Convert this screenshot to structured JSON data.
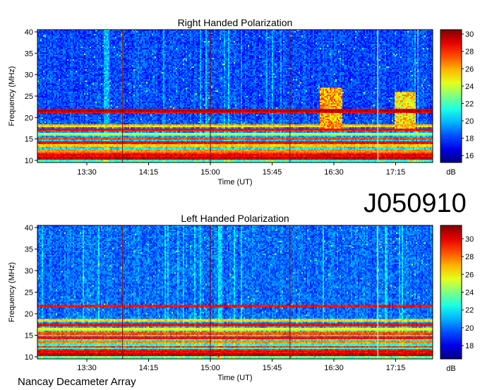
{
  "figure_id": "J050910",
  "footer": "Nancay Decameter Array",
  "chart_data": [
    {
      "type": "heatmap",
      "title": "Right Handed Polarization",
      "xlabel": "Time (UT)",
      "ylabel": "Frequency (MHz)",
      "x_ticks": [
        "13:30",
        "14:15",
        "15:00",
        "15:45",
        "16:30",
        "17:15"
      ],
      "x_tick_minutes": [
        810,
        855,
        900,
        945,
        990,
        1035
      ],
      "xlim_minutes": [
        774,
        1062
      ],
      "y_ticks": [
        10,
        15,
        20,
        25,
        30,
        35,
        40
      ],
      "ylim": [
        9.5,
        40.5
      ],
      "colorbar": {
        "label": "dB",
        "ticks": [
          16,
          18,
          20,
          22,
          24,
          26,
          28,
          30
        ],
        "range": [
          15.2,
          30.5
        ]
      },
      "base_level": 18.2,
      "bands": [
        {
          "f": 10.5,
          "level": 30,
          "width": 0.5
        },
        {
          "f": 11.3,
          "level": 29,
          "width": 0.4
        },
        {
          "f": 12.1,
          "level": 27,
          "width": 0.3
        },
        {
          "f": 13.4,
          "level": 26,
          "width": 0.4
        },
        {
          "f": 14.2,
          "level": 29,
          "width": 0.3
        },
        {
          "f": 15.1,
          "level": 28,
          "width": 0.4
        },
        {
          "f": 16.2,
          "level": 24,
          "width": 0.3
        },
        {
          "f": 17.2,
          "level": 29,
          "width": 0.3
        },
        {
          "f": 18.2,
          "level": 26,
          "width": 0.3
        },
        {
          "f": 21.6,
          "level": 30,
          "width": 0.4
        }
      ],
      "bursts": [
        {
          "t0": 980,
          "t1": 996,
          "f0": 17.5,
          "f1": 27,
          "level": 26
        },
        {
          "t0": 1034,
          "t1": 1050,
          "f0": 17.5,
          "f1": 26,
          "level": 25
        }
      ],
      "vlines": [
        {
          "t": 836,
          "kind": "red"
        },
        {
          "t": 900,
          "kind": "red"
        },
        {
          "t": 958,
          "kind": "red"
        },
        {
          "t": 1022,
          "kind": "bright"
        }
      ]
    },
    {
      "type": "heatmap",
      "title": "Left Handed Polarization",
      "xlabel": "Time (UT)",
      "ylabel": "Frequency (MHz)",
      "x_ticks": [
        "13:30",
        "14:15",
        "15:00",
        "15:45",
        "16:30",
        "17:15"
      ],
      "x_tick_minutes": [
        810,
        855,
        900,
        945,
        990,
        1035
      ],
      "xlim_minutes": [
        774,
        1062
      ],
      "y_ticks": [
        10,
        15,
        20,
        25,
        30,
        35,
        40
      ],
      "ylim": [
        9.5,
        40.5
      ],
      "colorbar": {
        "label": "dB",
        "ticks": [
          18,
          20,
          22,
          24,
          26,
          28,
          30
        ],
        "range": [
          16.5,
          31.5
        ]
      },
      "base_level": 20.0,
      "bands": [
        {
          "f": 10.5,
          "level": 31,
          "width": 0.5
        },
        {
          "f": 11.3,
          "level": 30,
          "width": 0.4
        },
        {
          "f": 12.3,
          "level": 29,
          "width": 0.3
        },
        {
          "f": 13.5,
          "level": 28,
          "width": 0.4
        },
        {
          "f": 14.4,
          "level": 30,
          "width": 0.3
        },
        {
          "f": 15.4,
          "level": 29,
          "width": 0.4
        },
        {
          "f": 16.5,
          "level": 26,
          "width": 0.3
        },
        {
          "f": 17.4,
          "level": 30,
          "width": 0.3
        },
        {
          "f": 18.4,
          "level": 27,
          "width": 0.3
        },
        {
          "f": 21.7,
          "level": 30,
          "width": 0.4
        }
      ],
      "bursts": [],
      "vlines": [
        {
          "t": 836,
          "kind": "red"
        },
        {
          "t": 900,
          "kind": "red"
        },
        {
          "t": 958,
          "kind": "red"
        },
        {
          "t": 1022,
          "kind": "bright"
        }
      ]
    }
  ]
}
